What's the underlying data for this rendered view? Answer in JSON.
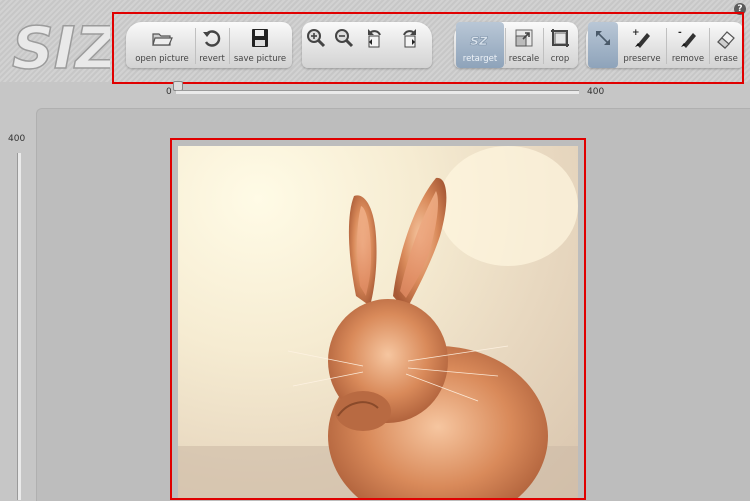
{
  "app": {
    "logo_text": "SIZR",
    "help_label": "?"
  },
  "toolbar": {
    "open_label": "open picture",
    "revert_label": "revert",
    "save_label": "save picture",
    "retarget_label": "retarget",
    "rescale_label": "rescale",
    "crop_label": "crop",
    "preserve_label": "preserve",
    "remove_label": "remove",
    "erase_label": "erase"
  },
  "width_slider": {
    "min_label": "0",
    "max_label": "400",
    "value": 0
  },
  "height_slider": {
    "max_label": "400"
  },
  "colors": {
    "highlight": "#e00000",
    "active_tab": "#8ea3ba"
  },
  "image": {
    "subject": "rabbit photo"
  }
}
